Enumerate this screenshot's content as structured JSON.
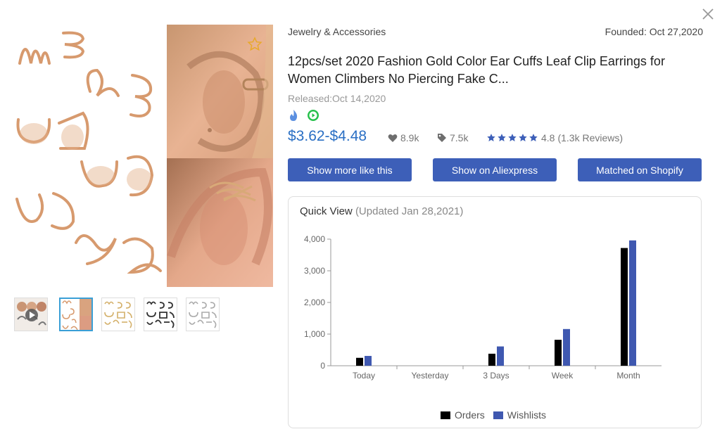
{
  "header": {
    "category": "Jewelry & Accessories",
    "founded": "Founded: Oct 27,2020"
  },
  "product": {
    "title": "12pcs/set 2020 Fashion Gold Color Ear Cuffs Leaf Clip Earrings for Women Climbers No Piercing Fake C...",
    "released": "Released:Oct 14,2020",
    "price": "$3.62-$4.48",
    "likes": "8.9k",
    "tags": "7.5k",
    "rating": "4.8",
    "reviews": "(1.3k Reviews)",
    "stars": 5
  },
  "gallery": {
    "thumb_count": 5,
    "active_index": 1
  },
  "buttons": {
    "show_more": "Show more like this",
    "aliexpress": "Show on Aliexpress",
    "shopify": "Matched on Shopify"
  },
  "quick_view": {
    "label": "Quick View",
    "updated": "(Updated Jan 28,2021)"
  },
  "colors": {
    "accent": "#3d5fb8",
    "price": "#2a6fc4",
    "orders": "#000000",
    "wishlists": "#3f58b0",
    "star": "#3d5fb8"
  },
  "chart_data": {
    "type": "bar",
    "categories": [
      "Today",
      "Yesterday",
      "3 Days",
      "Week",
      "Month"
    ],
    "series": [
      {
        "name": "Orders",
        "values": [
          250,
          0,
          380,
          820,
          3720
        ]
      },
      {
        "name": "Wishlists",
        "values": [
          310,
          0,
          610,
          1160,
          3960
        ]
      }
    ],
    "yticks": [
      "0",
      "1,000",
      "2,000",
      "3,000",
      "4,000"
    ],
    "ylim": [
      0,
      4000
    ],
    "legend": "bottom"
  }
}
